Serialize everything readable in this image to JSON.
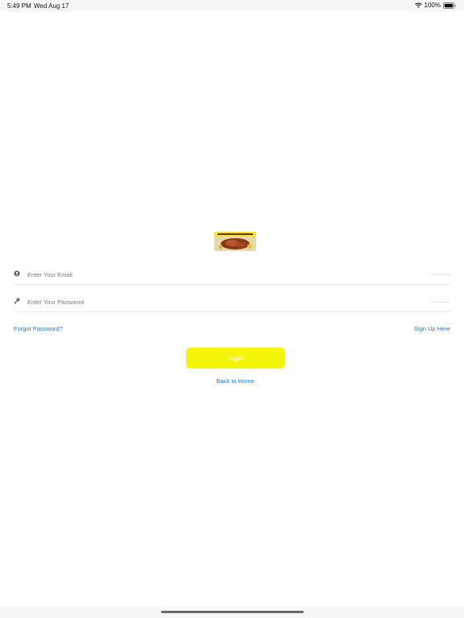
{
  "status_bar": {
    "time": "5:49 PM",
    "date": "Wed Aug 17",
    "battery": "100%",
    "icons": [
      "wifi-icon",
      "battery-icon"
    ]
  },
  "logo": {
    "icon": "restaurant-logo-roast-chicken",
    "colors": {
      "banner": "#f2e23a",
      "food": "#8a3a1c"
    }
  },
  "form": {
    "email": {
      "icon": "user-icon",
      "value": "",
      "placeholder": "Enter Your Email"
    },
    "password": {
      "icon": "key-icon",
      "value": "",
      "placeholder": "Enter Your Password"
    }
  },
  "links": {
    "forgot_password": "Forgot Password?",
    "sign_up": "Sign Up Here",
    "back_home": "Back to Home"
  },
  "login_button": {
    "label": "Login",
    "color": "#f5f50a"
  },
  "colors": {
    "link": "#1f78c8",
    "divider": "#e8e8e8",
    "background": "#ffffff"
  }
}
